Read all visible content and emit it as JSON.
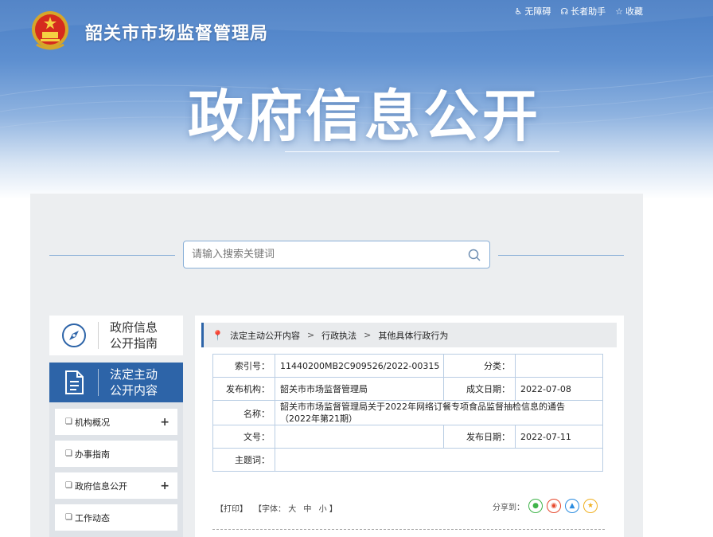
{
  "header": {
    "site_name": "韶关市市场监督管理局",
    "big_title": "政府信息公开",
    "links": [
      {
        "icon": "accessibility-icon",
        "label": "无障碍"
      },
      {
        "icon": "elder-assistant-icon",
        "label": "长者助手"
      },
      {
        "icon": "star-icon",
        "label": "收藏"
      }
    ]
  },
  "search": {
    "placeholder": "请输入搜索关键词"
  },
  "sidebar": {
    "guide_card": {
      "line1": "政府信息",
      "line2": "公开指南",
      "icon": "compass-icon"
    },
    "active_card": {
      "line1": "法定主动",
      "line2": "公开内容",
      "icon": "document-icon"
    },
    "items": [
      {
        "label": "机构概况",
        "has_plus": "+"
      },
      {
        "label": "办事指南",
        "has_plus": ""
      },
      {
        "label": "政府信息公开",
        "has_plus": "+"
      },
      {
        "label": "工作动态",
        "has_plus": ""
      }
    ]
  },
  "breadcrumb": {
    "items": [
      "法定主动公开内容",
      "行政执法",
      "其他具体行政行为"
    ],
    "separator": ">"
  },
  "info": {
    "index_label": "索引号：",
    "index_value": "11440200MB2C909526/2022-00315",
    "category_label": "分类：",
    "category_value": "",
    "publisher_label": "发布机构：",
    "publisher_value": "韶关市市场监督管理局",
    "created_label": "成文日期：",
    "created_value": "2022-07-08",
    "name_label": "名称：",
    "name_value_line1": "韶关市市场监督管理局关于2022年网络订餐专项食品监督抽检信息的通告",
    "name_value_line2": "（2022年第21期）",
    "docno_label": "文号：",
    "docno_value": "",
    "published_label": "发布日期：",
    "published_value": "2022-07-11",
    "subject_label": "主题词：",
    "subject_value": ""
  },
  "tools": {
    "print": "【打印】",
    "font_prefix": "【字体：",
    "font_large": "大",
    "font_medium": "中",
    "font_small": "小",
    "font_suffix": "】",
    "share_label": "分享到："
  },
  "colors": {
    "brand_blue": "#2d64a8",
    "wechat": "#3fb44a",
    "weibo": "#e6492d",
    "qq": "#2a8ce0",
    "qzone": "#f0b020"
  }
}
